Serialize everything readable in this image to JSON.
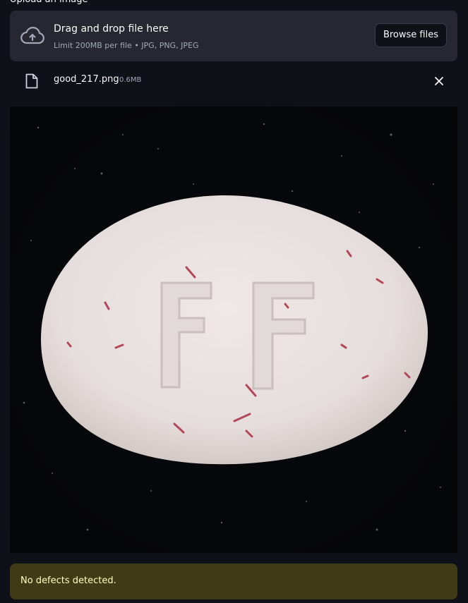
{
  "uploader": {
    "label": "Upload an image",
    "drop_title": "Drag and drop file here",
    "drop_hint": "Limit 200MB per file • JPG, PNG, JPEG",
    "browse_label": "Browse files",
    "icon": "cloud-upload-icon"
  },
  "file": {
    "name": "good_217.png",
    "size": "0.6MB",
    "icon": "file-icon",
    "remove_icon": "close-icon"
  },
  "preview": {
    "embossed_text": "FF"
  },
  "result": {
    "message": "No defects detected.",
    "color": "#3e3b16",
    "text_color": "#ffffc2"
  },
  "colors": {
    "background": "#0e1117",
    "panel": "#262730"
  }
}
